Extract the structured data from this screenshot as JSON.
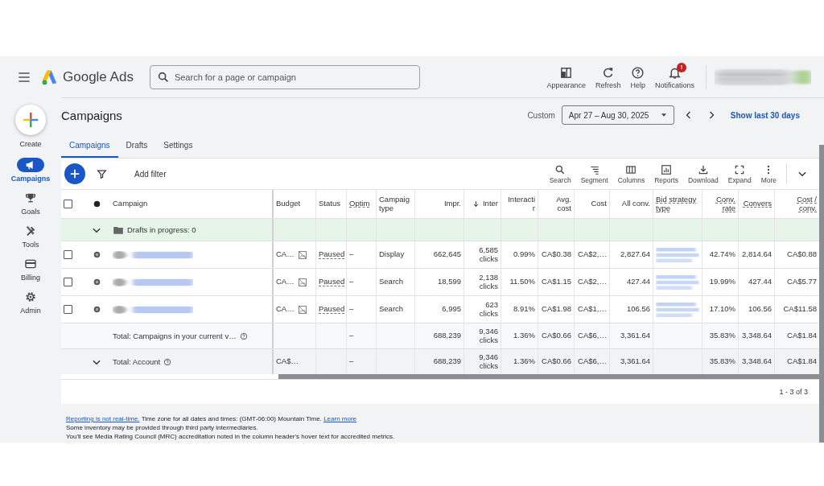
{
  "header": {
    "product": "Google Ads",
    "search": {
      "placeholder": "Search for a page or campaign"
    },
    "actions": [
      {
        "kind": "appearance",
        "label": "Appearance"
      },
      {
        "kind": "refresh",
        "label": "Refresh"
      },
      {
        "kind": "help",
        "label": "Help"
      },
      {
        "kind": "notifications",
        "label": "Notifications",
        "badge": "!"
      }
    ]
  },
  "sidebar": {
    "create": "Create",
    "items": [
      {
        "kind": "campaigns",
        "label": "Campaigns",
        "selected": true
      },
      {
        "kind": "goals",
        "label": "Goals",
        "selected": false
      },
      {
        "kind": "tools",
        "label": "Tools",
        "selected": false
      },
      {
        "kind": "billing",
        "label": "Billing",
        "selected": false
      },
      {
        "kind": "admin",
        "label": "Admin",
        "selected": false
      }
    ]
  },
  "page": {
    "title": "Campaigns",
    "date_label": "Custom",
    "date_range": "Apr 27 – Aug 30, 2025",
    "show_last": "Show last 30 days",
    "tabs": [
      {
        "label": "Campaigns",
        "selected": true
      },
      {
        "label": "Drafts",
        "selected": false
      },
      {
        "label": "Settings",
        "selected": false
      }
    ]
  },
  "toolbar": {
    "add_filter": "Add filter",
    "tools": [
      {
        "kind": "search",
        "label": "Search"
      },
      {
        "kind": "segment",
        "label": "Segment"
      },
      {
        "kind": "columns",
        "label": "Columns"
      },
      {
        "kind": "reports",
        "label": "Reports"
      },
      {
        "kind": "download",
        "label": "Download"
      },
      {
        "kind": "expand",
        "label": "Expand"
      },
      {
        "kind": "more",
        "label": "More"
      }
    ]
  },
  "table": {
    "select_all": false,
    "columns": [
      {
        "label": "Campaign",
        "numeric": false
      },
      {
        "label": "Budget",
        "numeric": false,
        "kind": "budget"
      },
      {
        "label": "Status",
        "numeric": false,
        "underlined_cells": true
      },
      {
        "label": "Optim",
        "numeric": false,
        "dotted": true
      },
      {
        "label": "Campaig\ntype",
        "numeric": false
      },
      {
        "label": "Impr.",
        "numeric": true
      },
      {
        "label": "Inter",
        "numeric": true,
        "sorted": true
      },
      {
        "label": "Interacti\nr",
        "numeric": true
      },
      {
        "label": "Avg.\ncost",
        "numeric": true
      },
      {
        "label": "Cost",
        "numeric": true
      },
      {
        "label": "All conv.",
        "numeric": true
      },
      {
        "label": "Bid strategy\ntype",
        "numeric": false,
        "dotted": true
      },
      {
        "label": "Conv.\nrate",
        "numeric": true,
        "dotted": true
      },
      {
        "label": "Convers",
        "numeric": true,
        "dotted": true
      },
      {
        "label": "Cost /\nconv.",
        "numeric": true,
        "dotted": true
      }
    ],
    "rows": [
      {
        "kind": "group",
        "label": "Drafts in progress: 0",
        "expanded": false
      },
      {
        "kind": "campaign",
        "checked": false,
        "paused": true,
        "cells": [
          "CA…",
          "Paused",
          "–",
          "Display",
          "662,645",
          "6,585\nclicks",
          "0.99%",
          "CA$0.38",
          "CA$2,…",
          "2,827.64",
          null,
          "42.74%",
          "2,814.64",
          "CA$0.88"
        ]
      },
      {
        "kind": "campaign",
        "checked": false,
        "paused": true,
        "cells": [
          "CA…",
          "Paused",
          "–",
          "Search",
          "18,599",
          "2,138\nclicks",
          "11.50%",
          "CA$1.15",
          "CA$2,…",
          "427.44",
          null,
          "19.99%",
          "427.44",
          "CA$5.77"
        ]
      },
      {
        "kind": "campaign",
        "checked": false,
        "paused": true,
        "cells": [
          "CA…",
          "Paused",
          "–",
          "Search",
          "6,995",
          "623\nclicks",
          "8.91%",
          "CA$1.98",
          "CA$1,…",
          "106.56",
          null,
          "17.10%",
          "106.56",
          "CA$11.58"
        ]
      },
      {
        "kind": "total",
        "label": "Total: Campaigns in your current v…",
        "cells": [
          null,
          null,
          "–",
          null,
          "688,239",
          "9,346\nclicks",
          "1.36%",
          "CA$0.66",
          "CA$6,…",
          "3,361.64",
          null,
          "35.83%",
          "3,348.64",
          "CA$1.84"
        ]
      },
      {
        "kind": "total",
        "label": "Total: Account",
        "expanded": false,
        "cells": [
          "CA$…",
          null,
          "–",
          null,
          "688,239",
          "9,346\nclicks",
          "1.36%",
          "CA$0.66",
          "CA$6,…",
          "3,361.64",
          null,
          "35.83%",
          "3,348.64",
          "CA$1.84"
        ]
      }
    ],
    "pagination": "1 - 3 of 3"
  },
  "footer": {
    "lines": [
      [
        {
          "kind": "link",
          "text": "Reporting is not real-time."
        },
        {
          "kind": "text",
          "text": " Time zone for all dates and times: (GMT-06:00) Mountain Time. "
        },
        {
          "kind": "link",
          "text": "Learn more"
        }
      ],
      [
        {
          "kind": "text",
          "text": "Some inventory may be provided through third party intermediaries."
        }
      ],
      [
        {
          "kind": "text",
          "text": "You'll see Media Rating Council (MRC) accreditation noted in the column header's hover text for accredited metrics."
        }
      ]
    ]
  }
}
